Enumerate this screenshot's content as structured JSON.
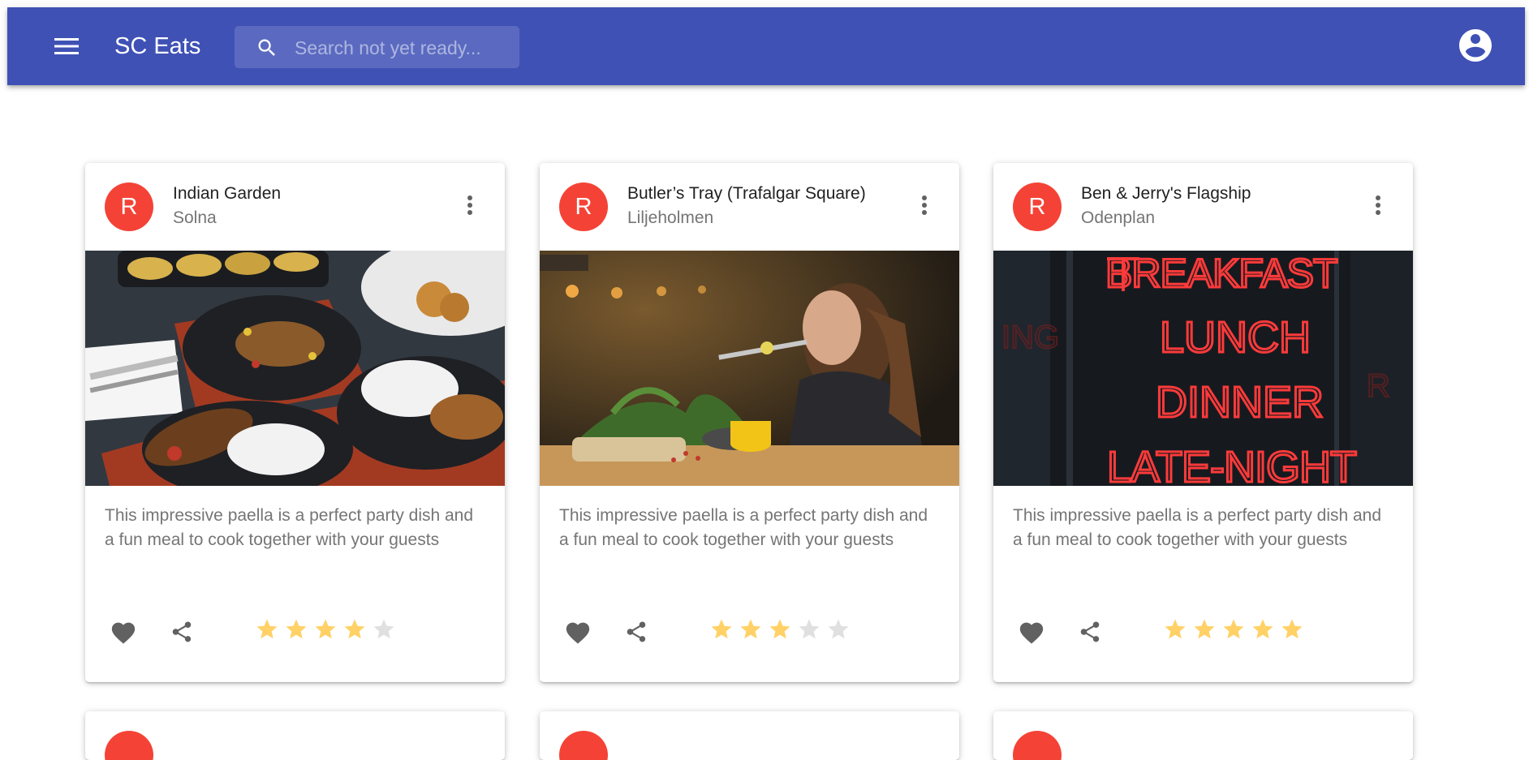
{
  "appbar": {
    "title": "SC Eats",
    "menu_icon": "menu-icon",
    "search": {
      "placeholder": "Search not yet ready...",
      "icon": "search-icon"
    },
    "account_icon": "account-circle-icon",
    "color": "#3f51b5"
  },
  "avatar_color": "#f44336",
  "star_color_on": "#ffd166",
  "star_color_off": "#e0e0e0",
  "cards": [
    {
      "avatar": "R",
      "title": "Indian Garden",
      "subtitle": "Solna",
      "description": "This impressive paella is a perfect party dish and a fun meal to cook together with your guests",
      "rating": 4,
      "max_rating": 5
    },
    {
      "avatar": "R",
      "title": "Butler’s Tray (Trafalgar Square)",
      "subtitle": "Liljeholmen",
      "description": "This impressive paella is a perfect party dish and a fun meal to cook together with your guests",
      "rating": 3,
      "max_rating": 5
    },
    {
      "avatar": "R",
      "title": "Ben & Jerry's Flagship",
      "subtitle": "Odenplan",
      "description": "This impressive paella is a perfect party dish and a fun meal to cook together with your guests",
      "rating": 5,
      "max_rating": 5
    }
  ]
}
